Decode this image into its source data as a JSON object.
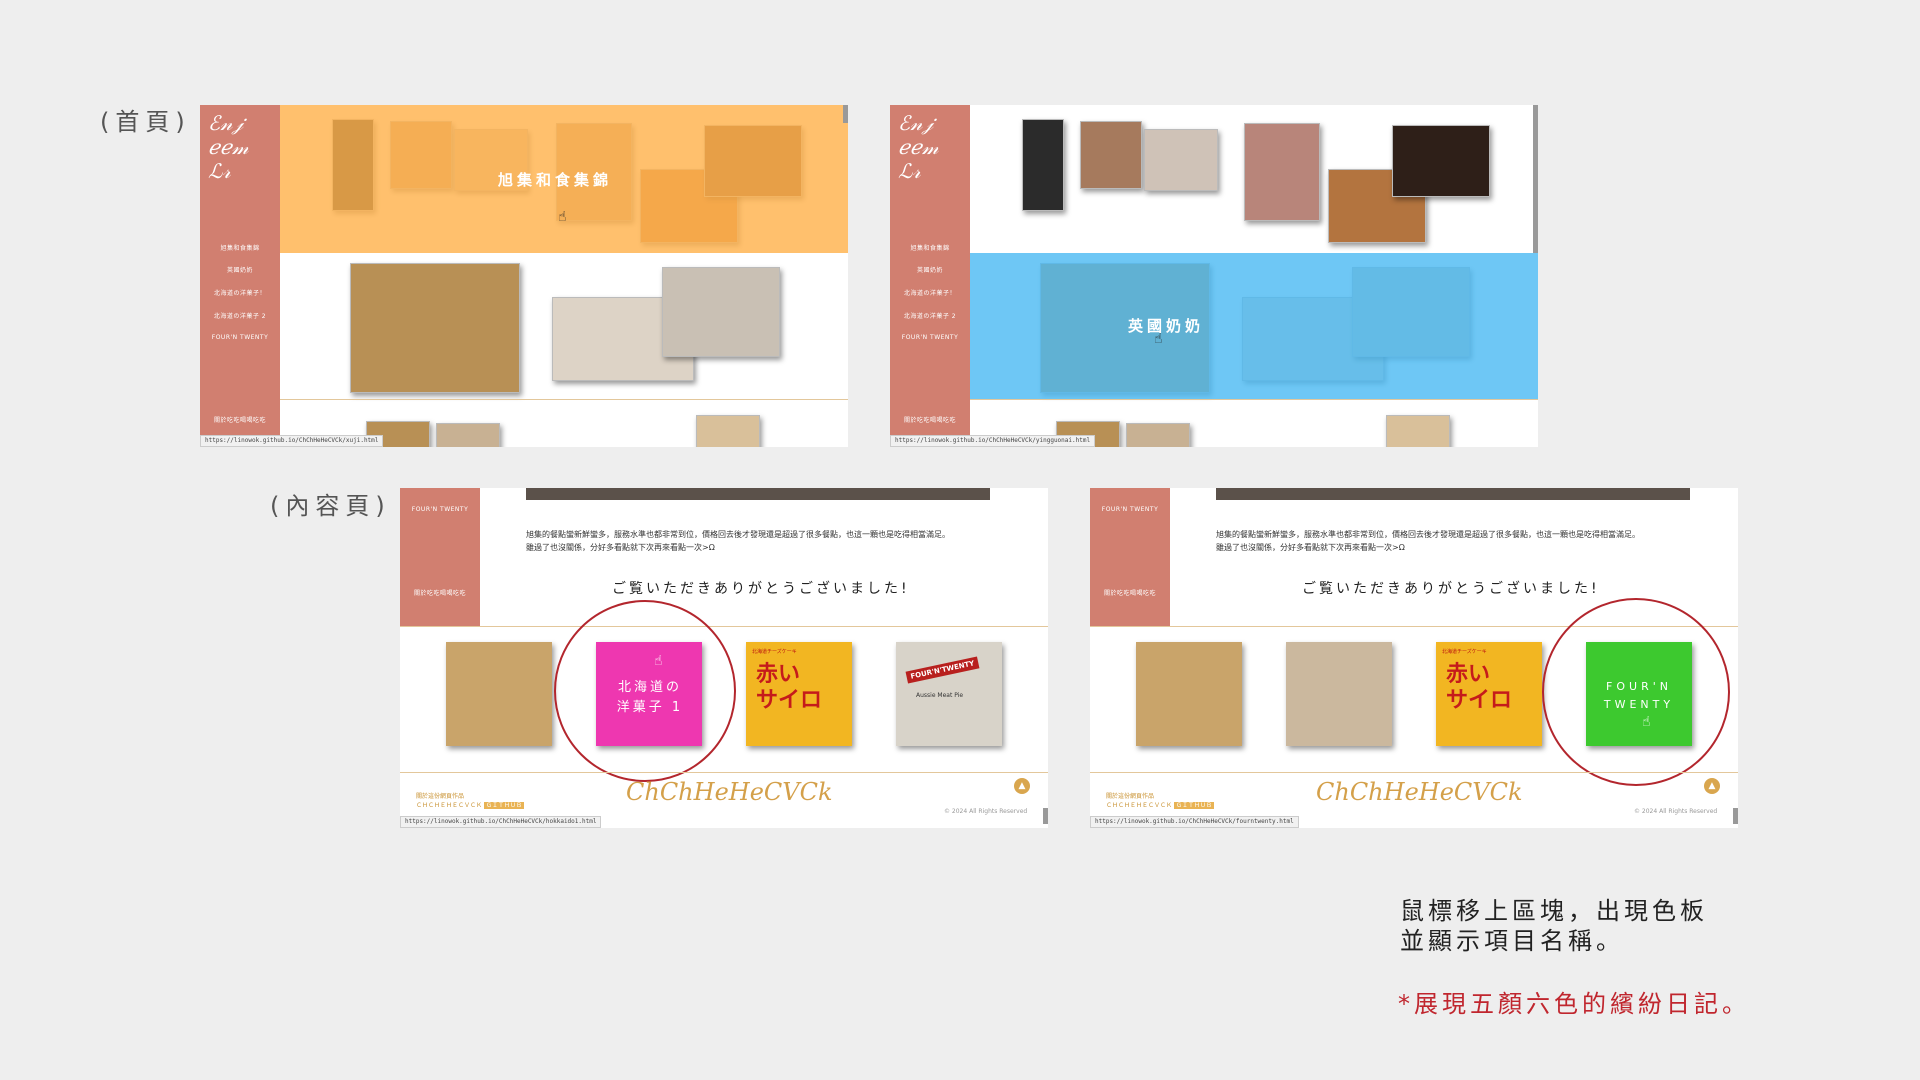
{
  "captions": {
    "home": "(首頁)",
    "content": "(內容頁)",
    "note_line1": "鼠標移上區塊，出現色板",
    "note_line2": "並顯示項目名稱。",
    "note_red": "*展現五顏六色的繽紛日記。"
  },
  "colors": {
    "sidebar": "#d17f70",
    "orange_overlay": "#ffb24d",
    "blue_overlay": "#4ab9f2",
    "pink_overlay": "#ee37b0",
    "green_overlay": "#3dc92f",
    "red_circle": "#b3262d",
    "note_red": "#c0262e"
  },
  "home_nav": [
    "旭集和食集錦",
    "英國奶奶",
    "北海道の洋菓子！",
    "北海道の洋菓子 2",
    "FOUR'N TWENTY"
  ],
  "home_nav_bottom": "關於吃吃喝喝吃吃",
  "shot1": {
    "hover_label": "旭集和食集錦",
    "url": "https://linowok.github.io/ChChHeHeCVCk/xuji.html"
  },
  "shot2": {
    "hover_label": "英國奶奶",
    "url": "https://linowok.github.io/ChChHeHeCVCk/yingguonai.html"
  },
  "content_nav": {
    "top": "FOUR'N TWENTY",
    "bottom": "關於吃吃喝喝吃吃"
  },
  "paragraph": {
    "line1": "旭集的餐點蠻新鮮蠻多，服務水準也都非常到位，價格回去後才發現還是超過了很多餐點，也這一顆也是吃得相當滿足。",
    "line2": "雖過了也沒關係，分好多看點就下次再來看點一次>Ω"
  },
  "thanks": "ご覧いただきありがとうございました!",
  "shot3": {
    "hover_label_line1": "北海道の",
    "hover_label_line2": "洋菓子 1",
    "url": "https://linowok.github.io/ChChHeHeCVCk/hokkaido1.html"
  },
  "shot4": {
    "hover_label_line1": "FOUR'N",
    "hover_label_line2": "TWENTY",
    "url": "https://linowok.github.io/ChChHeHeCVCk/fourntwenty.html"
  },
  "product_text": {
    "akai_top": "北海道チーズケーキ",
    "akai_main1": "赤い",
    "akai_main2": "サイロ",
    "fourn": "FOUR'N'TWENTY",
    "fourn_sub": "Aussie Meat Pie"
  },
  "footer": {
    "left1": "關於這份網頁作品",
    "left2": "ＣＨＣＨＥＨＥＣＶＣＫ",
    "left_tag": "ＧＩＴＨＵＢ",
    "right": "© 2024 All Rights Reserved",
    "script": "ChChHeHeCVCk"
  }
}
